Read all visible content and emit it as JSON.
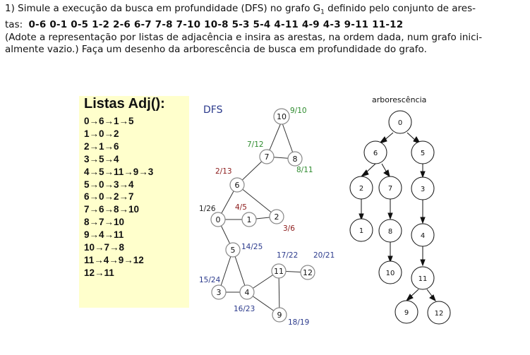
{
  "question": {
    "line1_prefix": "1) Simule a execução da busca em profundidade (DFS) no grafo G",
    "line1_sub": "1",
    "line1_suffix": " definido pelo conjunto de ares-",
    "line2_prefix": "tas:",
    "edges": "0-6 0-1 0-5 1-2 2-6 6-7 7-8 7-10 10-8 5-3 5-4 4-11 4-9 4-3 9-11 11-12",
    "line3": "(Adote a representação por listas de adjacência e insira as arestas, na ordem dada, num grafo inici-",
    "line4": "almente vazio.) Faça um desenho da arborescência de busca em profundidade do grafo."
  },
  "adjacency": {
    "title": "Listas Adj():",
    "lines": [
      "0→6→1→5",
      "1→0→2",
      "2→1→6",
      "3→5→4",
      "4→5→11→9→3",
      "5→0→3→4",
      "6→0→2→7",
      "7→6→8→10",
      "8→7→10",
      "9→4→11",
      "10→7→8",
      "11→4→9→12",
      "12→11"
    ]
  },
  "graph": {
    "label": "DFS",
    "nodes": [
      "10",
      "7",
      "8",
      "6",
      "0",
      "1",
      "2",
      "5",
      "11",
      "12",
      "3",
      "4",
      "9"
    ],
    "times": [
      {
        "text": "9/10",
        "color": "#2e8b2e"
      },
      {
        "text": "7/12",
        "color": "#2e8b2e"
      },
      {
        "text": "8/11",
        "color": "#2e8b2e"
      },
      {
        "text": "2/13",
        "color": "#8b1a1a"
      },
      {
        "text": "1/26",
        "color": "#222222"
      },
      {
        "text": "4/5",
        "color": "#8b1a1a"
      },
      {
        "text": "3/6",
        "color": "#8b1a1a"
      },
      {
        "text": "14/25",
        "color": "#2b3a8c"
      },
      {
        "text": "17/22",
        "color": "#2b3a8c"
      },
      {
        "text": "20/21",
        "color": "#2b3a8c"
      },
      {
        "text": "15/24",
        "color": "#2b3a8c"
      },
      {
        "text": "16/23",
        "color": "#2b3a8c"
      },
      {
        "text": "18/19",
        "color": "#2b3a8c"
      }
    ]
  },
  "tree": {
    "title": "arborescência",
    "nodes": [
      "0",
      "6",
      "5",
      "2",
      "7",
      "3",
      "1",
      "8",
      "4",
      "10",
      "11",
      "9",
      "12"
    ]
  }
}
